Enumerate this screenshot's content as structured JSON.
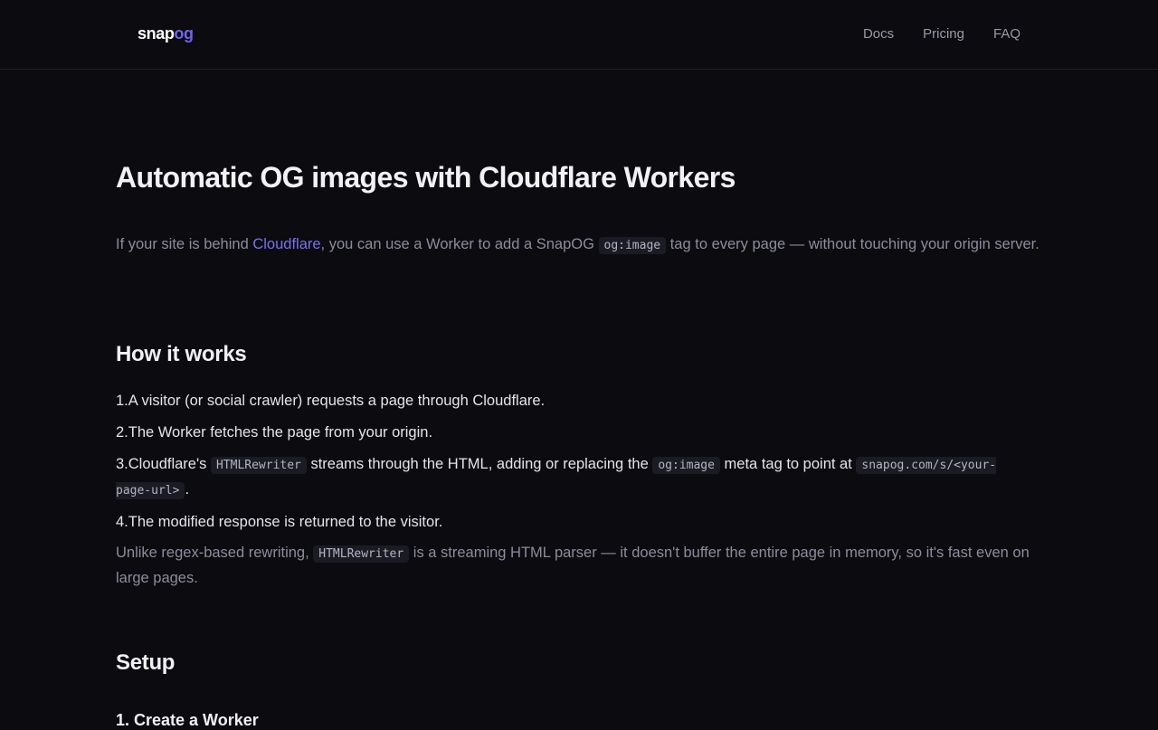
{
  "header": {
    "logo_main": "snap",
    "logo_accent": "og",
    "nav": [
      {
        "label": "Docs"
      },
      {
        "label": "Pricing"
      },
      {
        "label": "FAQ"
      }
    ]
  },
  "page": {
    "title": "Automatic OG images with Cloudflare Workers",
    "intro": {
      "part1": "If your site is behind ",
      "link": "Cloudflare",
      "part2": ", you can use a Worker to add a SnapOG ",
      "code": "og:image",
      "part3": " tag to every page — without touching your origin server."
    },
    "how_heading": "How it works",
    "steps": [
      {
        "num": "1.",
        "text": "A visitor (or social crawler) requests a page through Cloudflare."
      },
      {
        "num": "2.",
        "text": "The Worker fetches the page from your origin."
      },
      {
        "num": "3.",
        "part1": "Cloudflare's ",
        "code1": "HTMLRewriter",
        "part2": " streams through the HTML, adding or replacing the ",
        "code2": "og:image",
        "part3": " meta tag to point at ",
        "code3": "snapog.com/s/<your-page-url>",
        "part4": "."
      },
      {
        "num": "4.",
        "text": "The modified response is returned to the visitor."
      }
    ],
    "note": {
      "part1": "Unlike regex-based rewriting, ",
      "code": "HTMLRewriter",
      "part2": " is a streaming HTML parser — it doesn't buffer the entire page in memory, so it's fast even on large pages."
    },
    "setup_heading": "Setup",
    "setup_step1": "1. Create a Worker"
  }
}
